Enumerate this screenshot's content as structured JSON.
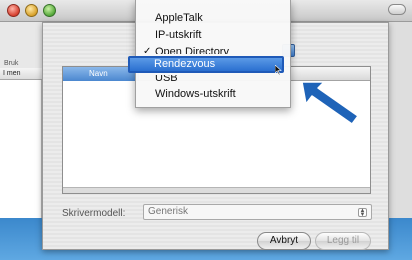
{
  "background_window": {
    "toolbar_label": "Bruk",
    "left_column_header": "I men"
  },
  "dropdown_menu": {
    "items": [
      {
        "label": "AppleTalk",
        "checked": false
      },
      {
        "label": "IP-utskrift",
        "checked": false
      },
      {
        "label": "Open Directory",
        "checked": true
      },
      {
        "label": "Rendezvous",
        "checked": false,
        "highlighted": true
      },
      {
        "label": "USB",
        "checked": false
      },
      {
        "label": "Windows-utskrift",
        "checked": false
      }
    ],
    "check_glyph": "✓"
  },
  "printer_list": {
    "column_header": "Navn"
  },
  "printer_model": {
    "label": "Skrivermodell:",
    "selected": "Generisk"
  },
  "buttons": {
    "cancel": "Avbryt",
    "add": "Legg til"
  },
  "colors": {
    "highlight": "#2a6fd0",
    "arrow": "#1e63b8"
  },
  "icons": {
    "pointer": "mouse-pointer-icon",
    "callout": "arrow-pointer-icon"
  }
}
